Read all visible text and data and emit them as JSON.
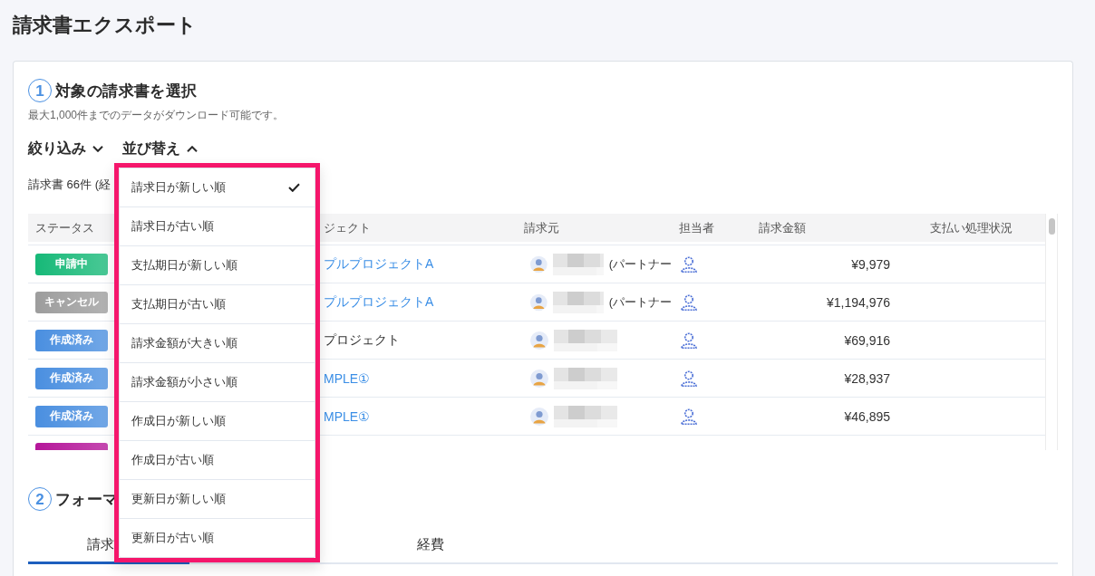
{
  "page": {
    "title": "請求書エクスポート"
  },
  "steps": [
    {
      "number": "1",
      "title": "対象の請求書を選択",
      "note": "最大1,000件までのデータがダウンロード可能です。",
      "toolbar": [
        {
          "label": "絞り込み",
          "expanded": false
        },
        {
          "label": "並び替え",
          "expanded": true,
          "menu": {
            "highlighted": true,
            "items": [
              {
                "label": "請求日が新しい順",
                "selected": true
              },
              {
                "label": "請求日が古い順",
                "selected": false
              },
              {
                "label": "支払期日が新しい順",
                "selected": false
              },
              {
                "label": "支払期日が古い順",
                "selected": false
              },
              {
                "label": "請求金額が大きい順",
                "selected": false
              },
              {
                "label": "請求金額が小さい順",
                "selected": false
              },
              {
                "label": "作成日が新しい順",
                "selected": false
              },
              {
                "label": "作成日が古い順",
                "selected": false
              },
              {
                "label": "更新日が新しい順",
                "selected": false
              },
              {
                "label": "更新日が古い順",
                "selected": false
              }
            ]
          }
        }
      ],
      "count": "請求書 66件 (経",
      "table": {
        "columns": [
          "ステータス",
          "ジェクト",
          "請求元",
          "担当者",
          "請求金額",
          "支払い処理状況"
        ],
        "rows": [
          {
            "kind": "full",
            "status": {
              "label": "申請中",
              "color": "#17b978"
            },
            "project": {
              "label": "プルプロジェクトA",
              "link": true
            },
            "requester": {
              "blurred": true,
              "note": "(パートナー"
            },
            "amount": "¥9,979"
          },
          {
            "kind": "full",
            "status": {
              "label": "キャンセル",
              "color": "#9d9d9d"
            },
            "project": {
              "label": "プルプロジェクトA",
              "link": true
            },
            "requester": {
              "blurred": true,
              "note": "(パートナー"
            },
            "amount": "¥1,194,976"
          },
          {
            "kind": "full",
            "status": {
              "label": "作成済み",
              "color": "#4a8fe0"
            },
            "project": {
              "label": "プロジェクト",
              "link": false
            },
            "requester": {
              "blurred": true
            },
            "amount": "¥69,916"
          },
          {
            "kind": "full",
            "status": {
              "label": "作成済み",
              "color": "#4a8fe0"
            },
            "project": {
              "label": "MPLE①",
              "link": true
            },
            "requester": {
              "blurred": true
            },
            "amount": "¥28,937"
          },
          {
            "kind": "full",
            "status": {
              "label": "作成済み",
              "color": "#4a8fe0"
            },
            "project": {
              "label": "MPLE①",
              "link": true
            },
            "requester": {
              "blurred": true
            },
            "amount": "¥46,895"
          },
          {
            "kind": "cut",
            "status": {
              "color": "#b5169a"
            }
          }
        ]
      }
    },
    {
      "number": "2",
      "title": "フォーマ",
      "tabs": [
        {
          "label": "請求",
          "selected": true
        },
        {
          "label": "経費",
          "selected": false
        }
      ]
    }
  ]
}
